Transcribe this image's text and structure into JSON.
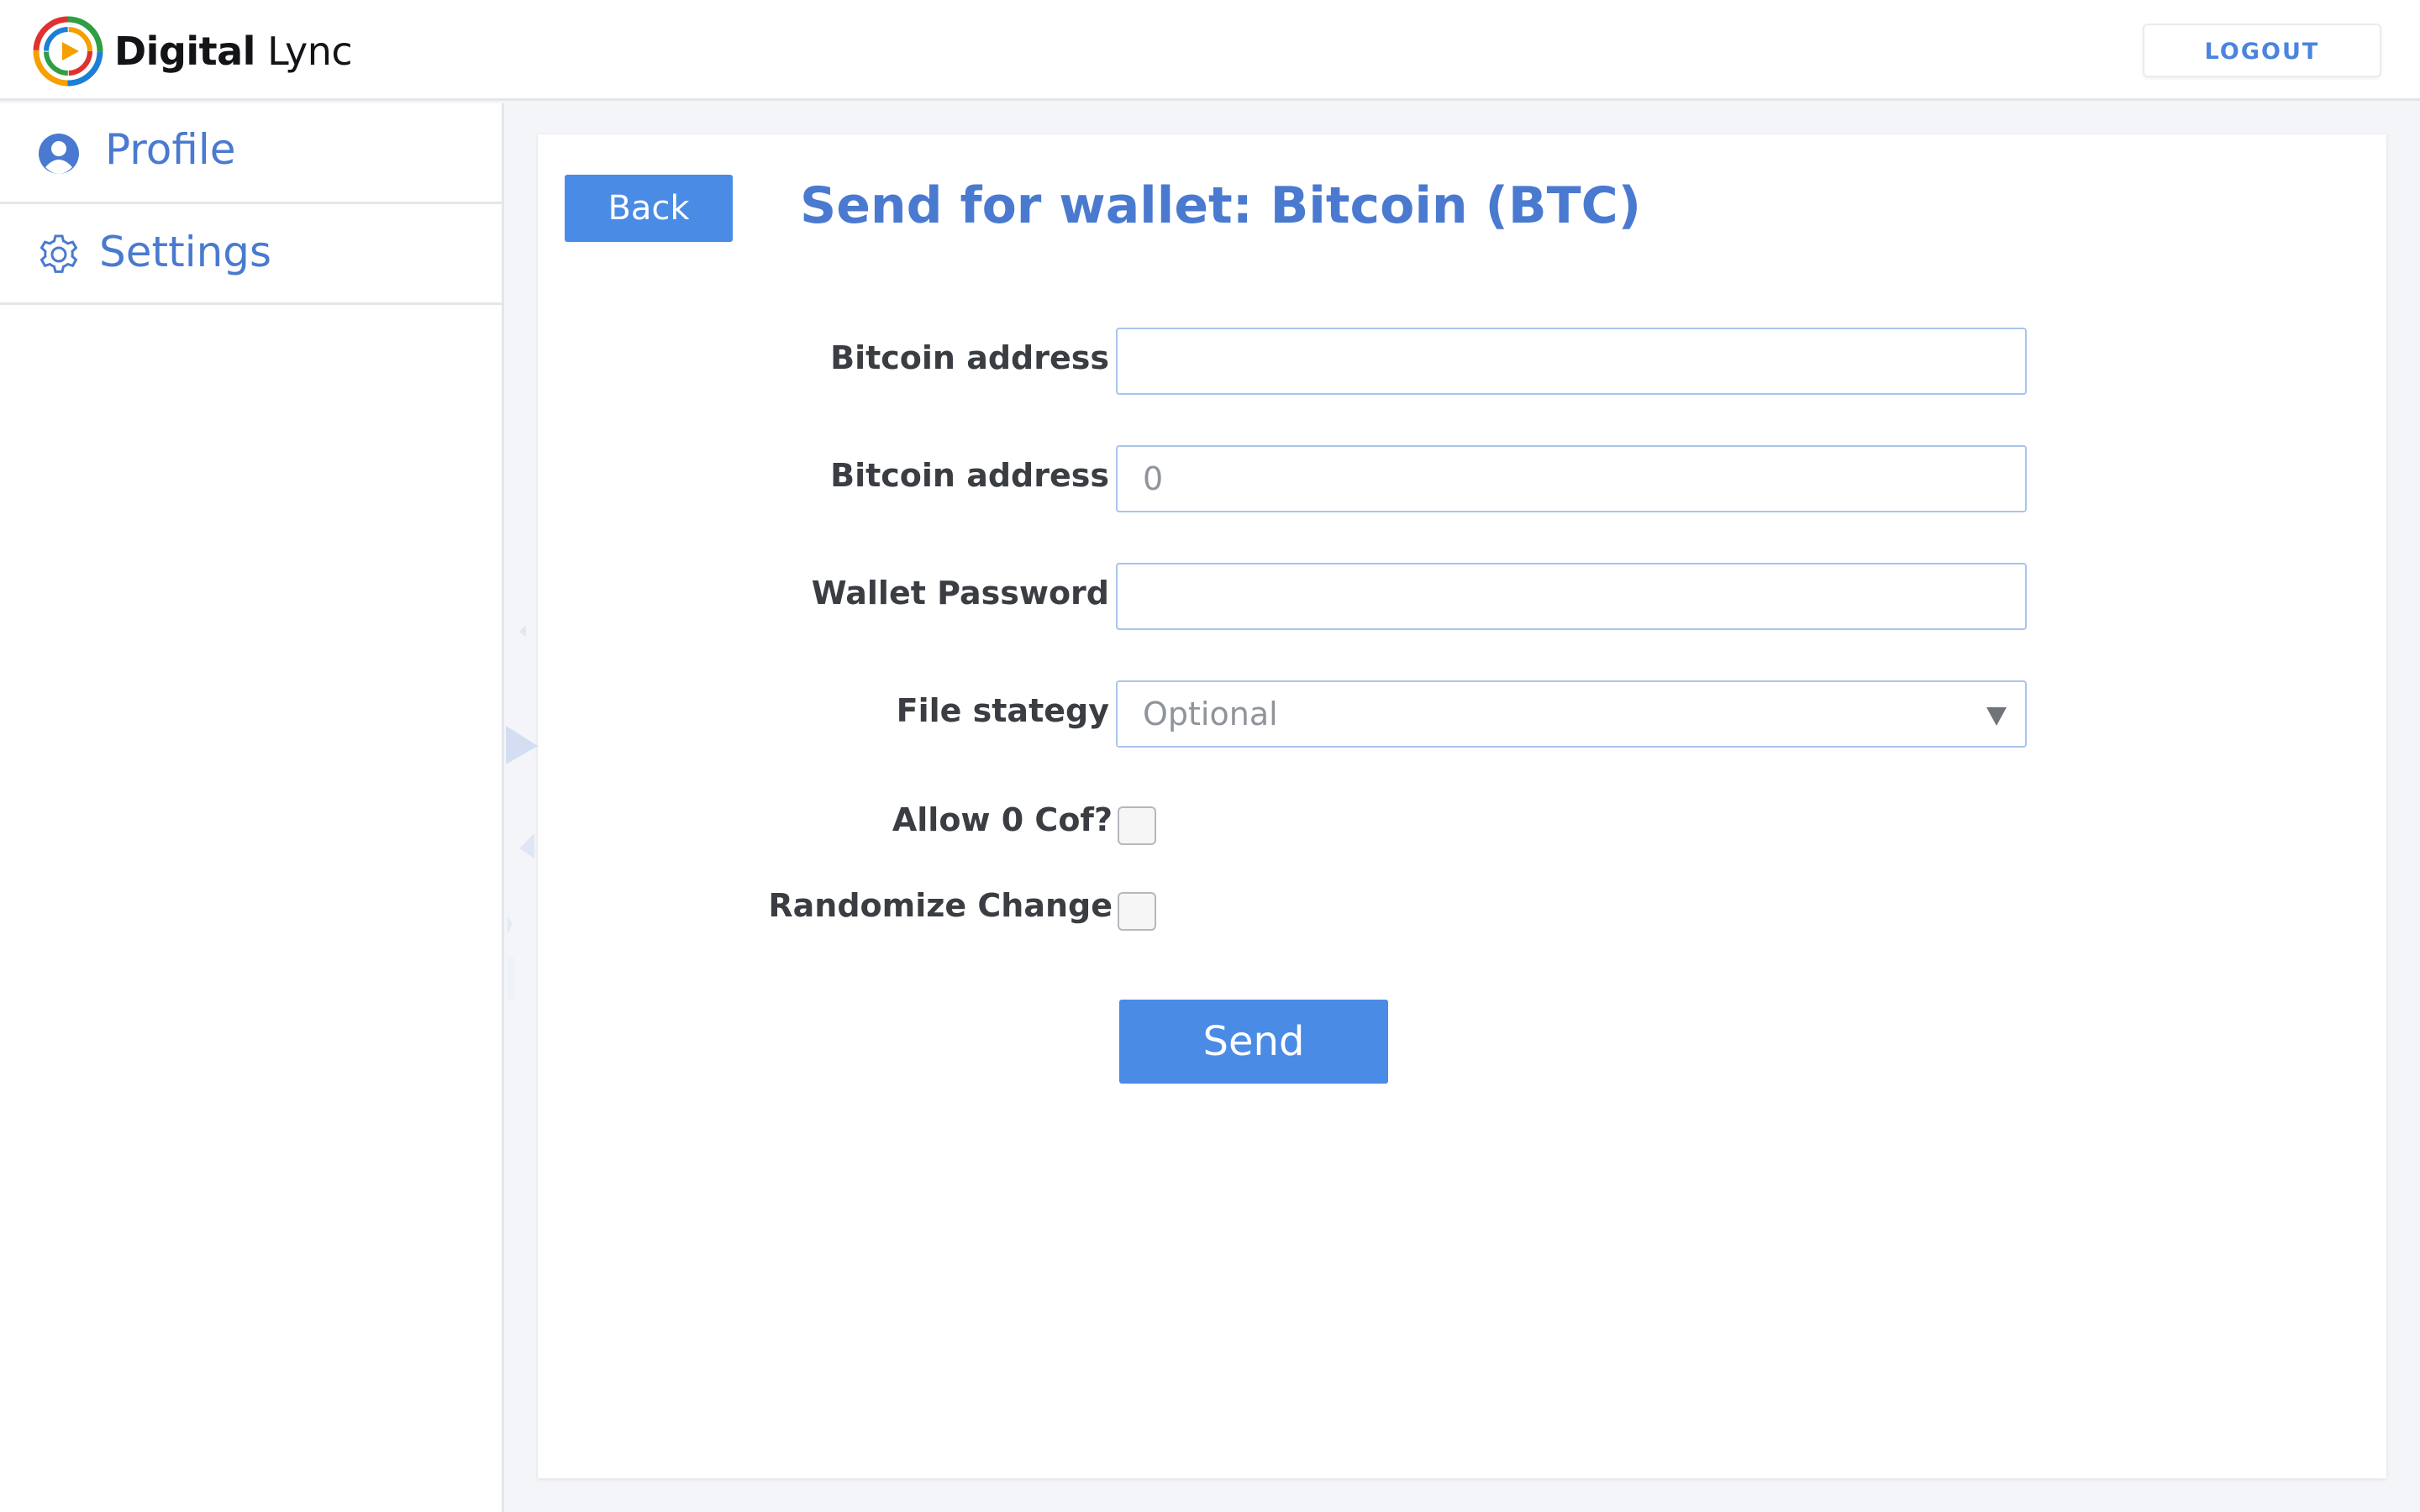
{
  "header": {
    "logo_bold": "Digital",
    "logo_light": "Lync",
    "logout_label": "LOGOUT"
  },
  "sidebar": {
    "items": [
      {
        "label": "Profile",
        "icon": "user-icon"
      },
      {
        "label": "Settings",
        "icon": "gear-icon"
      }
    ]
  },
  "main": {
    "back_label": "Back",
    "title": "Send for wallet: Bitcoin (BTC)",
    "fields": [
      {
        "label": "Bitcoin address",
        "value": "",
        "placeholder": ""
      },
      {
        "label": "Bitcoin address",
        "value": "",
        "placeholder": "0"
      },
      {
        "label": "Wallet Password",
        "value": "",
        "placeholder": ""
      }
    ],
    "strategy": {
      "label": "File stategy",
      "value": "Optional"
    },
    "checkboxes": [
      {
        "label": "Allow 0   Cof?",
        "checked": false
      },
      {
        "label": "Randomize Change",
        "checked": false
      }
    ],
    "send_label": "Send"
  },
  "colors": {
    "accent": "#4a8be6",
    "title": "#4a7ad0",
    "background": "#f4f5f8"
  }
}
